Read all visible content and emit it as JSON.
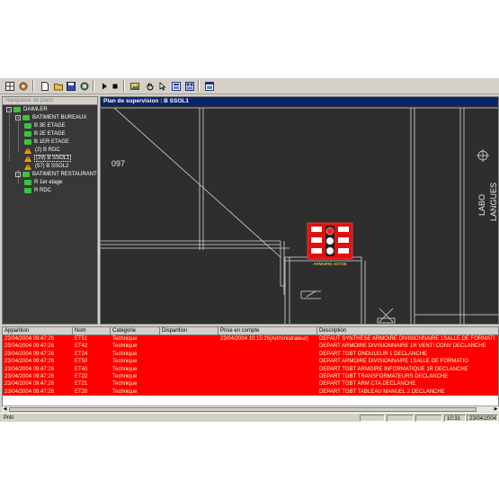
{
  "toolbar": {
    "buttons": [
      "grid-icon",
      "settings-icon",
      "new-icon",
      "open-icon",
      "save-icon",
      "network-icon",
      "play-icon",
      "stop-icon",
      "image-icon",
      "hand-icon",
      "pointer-icon",
      "zoom-icon",
      "layout-icon",
      "window-icon"
    ]
  },
  "tree": {
    "header": "Navigateur de plans",
    "items": [
      {
        "label": "DAIMLER",
        "icon": "folder",
        "expander": "-",
        "selected": false
      },
      {
        "label": "BATIMENT BUREAUX",
        "icon": "folder",
        "expander": "-",
        "selected": false
      },
      {
        "label": "B 3E ETAGE",
        "icon": "folder",
        "selected": false
      },
      {
        "label": "B 2E ETAGE",
        "icon": "folder",
        "selected": false
      },
      {
        "label": "B 1ER ETAGE",
        "icon": "folder",
        "selected": false
      },
      {
        "label": "(2) B RDC",
        "icon": "alarm",
        "selected": false
      },
      {
        "label": "(29) B SSOL1",
        "icon": "alarm",
        "selected": true
      },
      {
        "label": "(57) B SSOL2",
        "icon": "alarm",
        "selected": false
      },
      {
        "label": "BATIMENT RESTAURANT",
        "icon": "folder",
        "expander": "-",
        "selected": false
      },
      {
        "label": "R 1er etage",
        "icon": "folder",
        "selected": false
      },
      {
        "label": "R RDC",
        "icon": "folder",
        "selected": false
      }
    ]
  },
  "plan": {
    "title": "Plan de supervision : B SSOL1",
    "room_number": "097",
    "room_label_1": "LABO",
    "room_label_2": "LANGUES",
    "equipment_label": "ARMOIRE ADYSE"
  },
  "alarms": {
    "columns": [
      "Apparition",
      "Nom",
      "Catégorie",
      "Disparition",
      "Prise en compte",
      "Description"
    ],
    "rows": [
      {
        "apparition": "23/04/2004 09:47:26",
        "nom": "ET51",
        "categorie": "Technique",
        "disparition": "",
        "prise": "23/04/2004 10:15:26(Administrateur)",
        "description": "DEFAUT SYNTHESE ARMOIRE DIVISIONNAIRE 1SALLE DE FORMATI"
      },
      {
        "apparition": "23/04/2004 09:47:26",
        "nom": "ET42",
        "categorie": "Technique",
        "disparition": "",
        "prise": "",
        "description": "DEPART ARMOIRE DIVISIONNAIRE 1R VENTI CONV DECLANCHE"
      },
      {
        "apparition": "23/04/2004 09:47:26",
        "nom": "ET24",
        "categorie": "Technique",
        "disparition": "",
        "prise": "",
        "description": "DEPART TGBT ONDULEUR 1 DECLANCHE"
      },
      {
        "apparition": "23/04/2004 09:47:26",
        "nom": "ET50",
        "categorie": "Technique",
        "disparition": "",
        "prise": "",
        "description": "DEPART ARMOIRE DIVISIONNAIRE 1SALLE DE FORMATIO"
      },
      {
        "apparition": "23/04/2004 09:47:26",
        "nom": "ET40",
        "categorie": "Technique",
        "disparition": "",
        "prise": "",
        "description": "DEPART TGBT ARMOIRE INFORMATIQUE 1R DECLANCHE"
      },
      {
        "apparition": "23/04/2004 09:47:26",
        "nom": "ET22",
        "categorie": "Technique",
        "disparition": "",
        "prise": "",
        "description": "DEPART TGBT TRANSFORMATEURS DECLANCHE"
      },
      {
        "apparition": "23/04/2004 09:47:26",
        "nom": "ET21",
        "categorie": "Technique",
        "disparition": "",
        "prise": "",
        "description": "DEPART TGBT ARM CTA DECLANCHE"
      },
      {
        "apparition": "23/04/2004 09:47:26",
        "nom": "ET20",
        "categorie": "Technique",
        "disparition": "",
        "prise": "",
        "description": "DEPART TGBT TABLEAU MANUEL 2 DECLANCHE"
      }
    ]
  },
  "status": {
    "text": "Prêt",
    "time": "10:31",
    "date": "23/04/2004"
  },
  "colors": {
    "alarm_row": "#ff0000",
    "alarm_text": "#ffffc8",
    "plan_bg": "#2e2e2e",
    "title_bar": "#0a246a",
    "folder": "#3ec23e"
  }
}
